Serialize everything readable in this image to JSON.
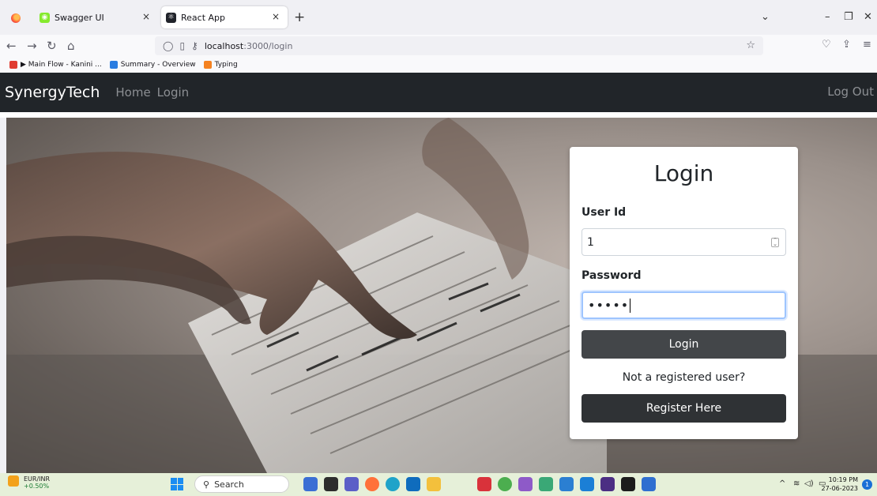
{
  "browser": {
    "tabs": [
      {
        "title": "Swagger UI",
        "active": false,
        "favicon_color": "#85ea2d"
      },
      {
        "title": "React App",
        "active": true,
        "favicon_color": "#20232a"
      }
    ],
    "close_glyph": "×",
    "new_tab_glyph": "+",
    "url_host": "localhost",
    "url_path": ":3000/login",
    "bookmarks": [
      {
        "label": "▶ Main Flow - Kanini ...",
        "icon_color": "#e03c31"
      },
      {
        "label": "Summary - Overview",
        "icon_color": "#2a7de1"
      },
      {
        "label": "Typing",
        "icon_color": "#f58220"
      }
    ]
  },
  "app": {
    "brand": "SynergyTech",
    "nav_links": [
      "Home",
      "Login"
    ],
    "logout": "Log Out"
  },
  "login": {
    "title": "Login",
    "user_id_label": "User Id",
    "user_id_value": "1",
    "password_label": "Password",
    "password_value": "•••••",
    "login_button": "Login",
    "not_registered": "Not a registered user?",
    "register_button": "Register Here"
  },
  "taskbar": {
    "currency_pair": "EUR/INR",
    "currency_change": "+0.50%",
    "search_placeholder": "Search",
    "time": "10:19 PM",
    "date": "27-06-2023",
    "notification_count": "1"
  },
  "colors": {
    "navbar_bg": "#212529",
    "login_button_bg": "#434649",
    "register_button_bg": "#2f3235",
    "focus_ring": "#9ec5fe"
  }
}
